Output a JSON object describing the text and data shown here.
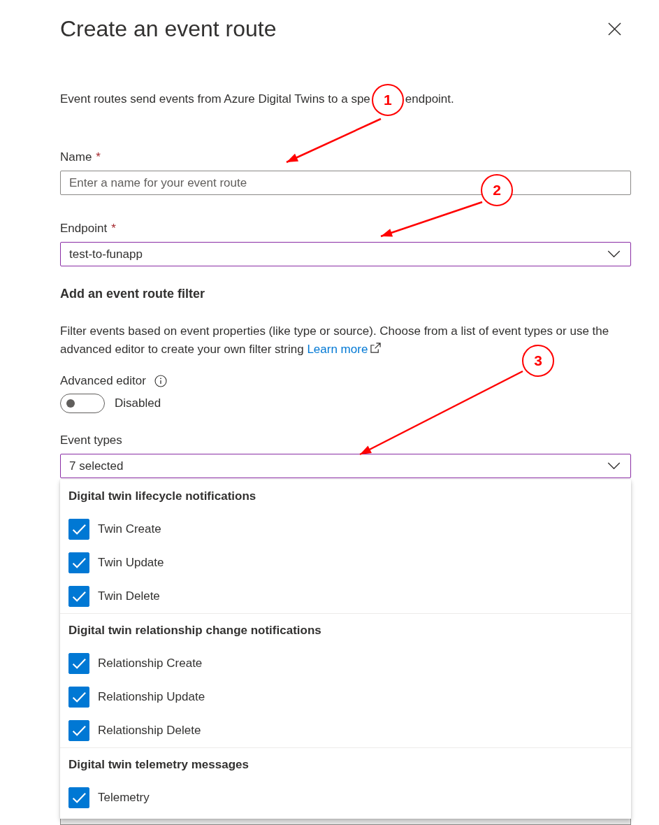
{
  "panel": {
    "title": "Create an event route"
  },
  "intro": {
    "text_before": "Event routes send events from Azure Digital Twins to a spe",
    "text_after": "endpoint."
  },
  "name_field": {
    "label": "Name",
    "required_mark": "*",
    "placeholder": "Enter a name for your event route"
  },
  "endpoint_field": {
    "label": "Endpoint",
    "required_mark": "*",
    "value": "test-to-funapp"
  },
  "filter_section": {
    "heading": "Add an event route filter",
    "description": "Filter events based on event properties (like type or source). Choose from a list of event types or use the advanced editor to create your own filter string",
    "link": "Learn more"
  },
  "advanced_editor": {
    "label": "Advanced editor",
    "on": false,
    "state_label": "Disabled"
  },
  "event_types": {
    "label": "Event types",
    "value": "7 selected",
    "expanded": true,
    "groups": [
      {
        "title": "Digital twin lifecycle notifications",
        "options": [
          {
            "label": "Twin Create",
            "checked": true
          },
          {
            "label": "Twin Update",
            "checked": true
          },
          {
            "label": "Twin Delete",
            "checked": true
          }
        ]
      },
      {
        "title": "Digital twin relationship change notifications",
        "options": [
          {
            "label": "Relationship Create",
            "checked": true
          },
          {
            "label": "Relationship Update",
            "checked": true
          },
          {
            "label": "Relationship Delete",
            "checked": true
          }
        ]
      },
      {
        "title": "Digital twin telemetry messages",
        "options": [
          {
            "label": "Telemetry",
            "checked": true
          }
        ]
      }
    ]
  },
  "annotations": [
    {
      "number": "1"
    },
    {
      "number": "2"
    },
    {
      "number": "3"
    }
  ]
}
